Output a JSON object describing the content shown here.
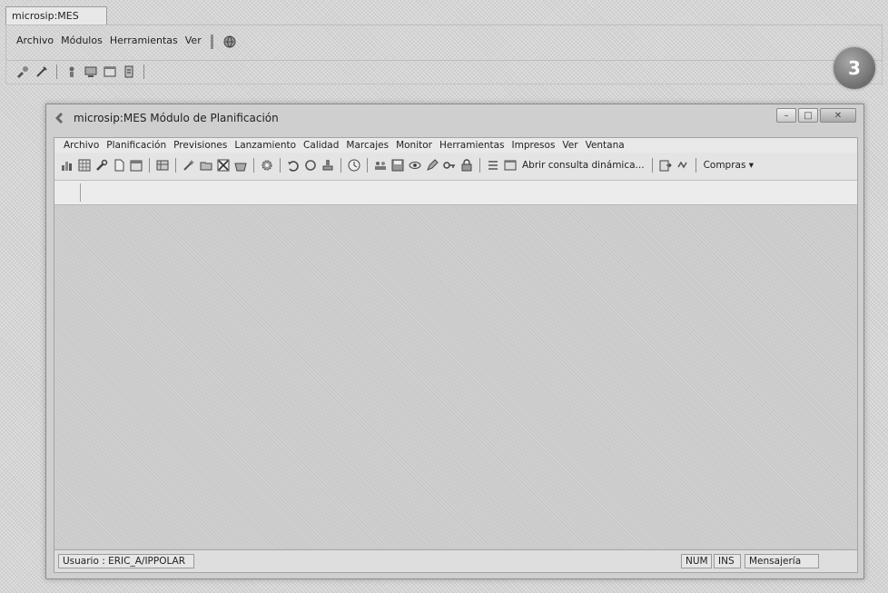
{
  "outer_window": {
    "title": "microsip:MES",
    "menu": [
      "Archivo",
      "Módulos",
      "Herramientas",
      "Ver"
    ],
    "help_icon": "globe-help-icon",
    "toolbar_icons": [
      "modules-icon",
      "tools-icon",
      "user-icon",
      "monitor-icon",
      "window-icon",
      "report-icon"
    ]
  },
  "step_badge": "3",
  "inner_window": {
    "title": "microsip:MES  Módulo de Planificación",
    "menu": [
      "Archivo",
      "Planificación",
      "Previsiones",
      "Lanzamiento",
      "Calidad",
      "Marcajes",
      "Monitor",
      "Herramientas",
      "Impresos",
      "Ver",
      "Ventana"
    ],
    "toolbar": {
      "dynamic_query_label": "Abrir consulta dinámica...",
      "purchases_label": "Compras",
      "icons": [
        "chart-icon",
        "grid-icon",
        "wrench-icon",
        "document-icon",
        "calendar-icon",
        "table-icon",
        "wizard-icon",
        "folder-icon",
        "cancel-x-icon",
        "basket-icon",
        "gear-icon",
        "undo-icon",
        "cycle-icon",
        "stamp-icon",
        "clock-icon",
        "people-icon",
        "save-icon",
        "eye-icon",
        "pen-icon",
        "key-icon",
        "lock-icon",
        "list-icon",
        "window-icon",
        "export-icon",
        "refresh-icon"
      ]
    },
    "status": {
      "user": "Usuario : ERIC_A/IPPOLAR",
      "num": "NUM",
      "ins": "INS",
      "messaging": "Mensajería"
    }
  }
}
